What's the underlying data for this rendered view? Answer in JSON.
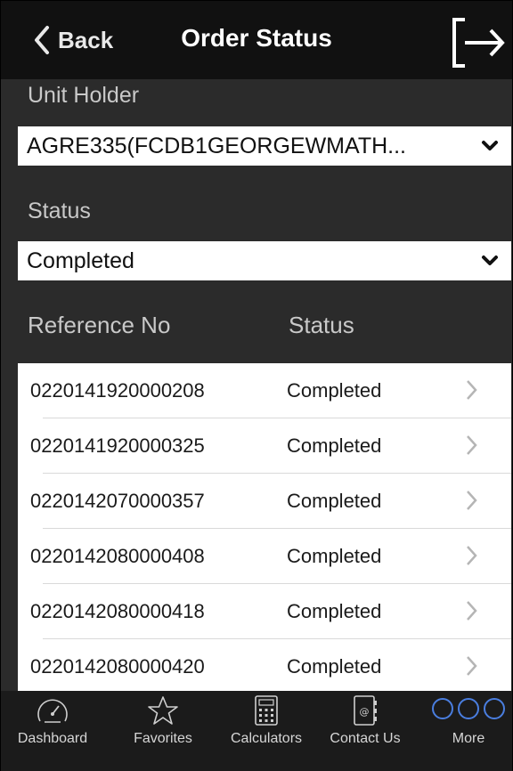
{
  "header": {
    "back_label": "Back",
    "title": "Order Status"
  },
  "filters": {
    "unit_holder_label": "Unit Holder",
    "unit_holder_value": "AGRE335(FCDB1GEORGEWMATH...",
    "status_label": "Status",
    "status_value": "Completed"
  },
  "table": {
    "columns": [
      "Reference No",
      "Status"
    ],
    "rows": [
      {
        "ref": "0220141920000208",
        "status": "Completed"
      },
      {
        "ref": "0220141920000325",
        "status": "Completed"
      },
      {
        "ref": "0220142070000357",
        "status": "Completed"
      },
      {
        "ref": "0220142080000408",
        "status": "Completed"
      },
      {
        "ref": "0220142080000418",
        "status": "Completed"
      },
      {
        "ref": "0220142080000420",
        "status": "Completed"
      }
    ]
  },
  "tabbar": {
    "items": [
      {
        "label": "Dashboard",
        "icon": "speedometer-icon"
      },
      {
        "label": "Favorites",
        "icon": "star-icon"
      },
      {
        "label": "Calculators",
        "icon": "calculator-icon"
      },
      {
        "label": "Contact Us",
        "icon": "address-book-icon"
      },
      {
        "label": "More",
        "icon": "more-circles-icon",
        "active": true
      }
    ]
  },
  "colors": {
    "background": "#2b2b2b",
    "navbar": "#111111",
    "accent": "#4a7ee0"
  }
}
